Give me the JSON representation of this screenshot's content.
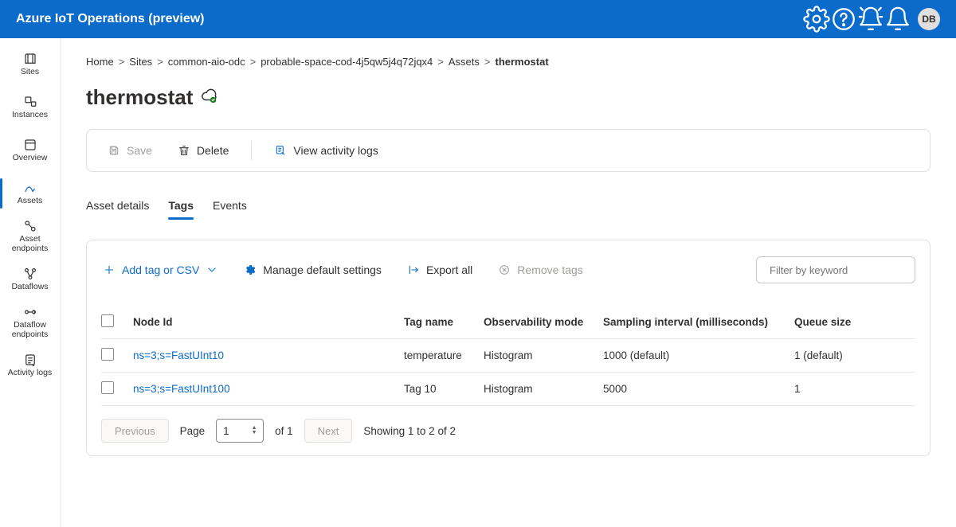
{
  "header": {
    "brand": "Azure IoT Operations (preview)",
    "avatar": "DB"
  },
  "sidebar": {
    "items": [
      {
        "key": "sites",
        "label": "Sites"
      },
      {
        "key": "instances",
        "label": "Instances"
      },
      {
        "key": "overview",
        "label": "Overview"
      },
      {
        "key": "assets",
        "label": "Assets"
      },
      {
        "key": "asset-endpoints",
        "label": "Asset endpoints"
      },
      {
        "key": "dataflows",
        "label": "Dataflows"
      },
      {
        "key": "dataflow-endpoints",
        "label": "Dataflow endpoints"
      },
      {
        "key": "activity-logs",
        "label": "Activity logs"
      }
    ],
    "active": "assets"
  },
  "breadcrumb": {
    "items": [
      "Home",
      "Sites",
      "common-aio-odc",
      "probable-space-cod-4j5qw5j4q72jqx4",
      "Assets",
      "thermostat"
    ]
  },
  "page": {
    "title": "thermostat"
  },
  "actions": {
    "save": "Save",
    "delete": "Delete",
    "activity": "View activity logs"
  },
  "tabs": {
    "items": [
      "Asset details",
      "Tags",
      "Events"
    ],
    "active": "Tags"
  },
  "tagsToolbar": {
    "add": "Add tag or CSV",
    "manage": "Manage default settings",
    "export": "Export all",
    "remove": "Remove tags",
    "filter_placeholder": "Filter by keyword"
  },
  "table": {
    "columns": {
      "node": "Node Id",
      "tagname": "Tag name",
      "obs": "Observability mode",
      "sampling": "Sampling interval (milliseconds)",
      "queue": "Queue size"
    },
    "rows": [
      {
        "node": "ns=3;s=FastUInt10",
        "tagname": "temperature",
        "obs": "Histogram",
        "sampling": "1000 (default)",
        "queue": "1 (default)"
      },
      {
        "node": "ns=3;s=FastUInt100",
        "tagname": "Tag 10",
        "obs": "Histogram",
        "sampling": "5000",
        "queue": "1"
      }
    ]
  },
  "pager": {
    "previous": "Previous",
    "next": "Next",
    "page_label": "Page",
    "page_value": "1",
    "of_label": "of 1",
    "showing": "Showing 1 to 2 of 2"
  }
}
